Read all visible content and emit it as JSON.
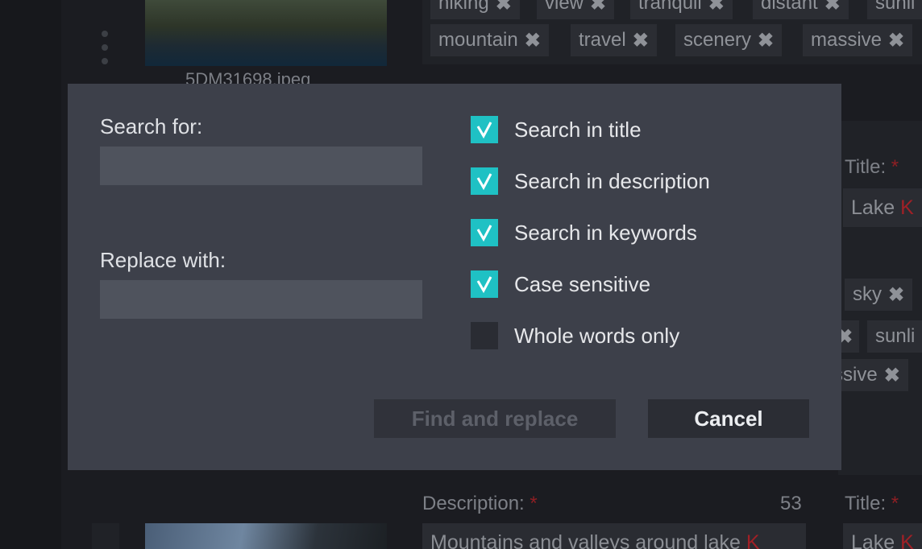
{
  "background": {
    "top_item": {
      "filename": "5DM31698.jpeg",
      "keywords_row1": [
        "hiking",
        "view",
        "tranquil",
        "distant",
        "sunli"
      ],
      "keywords_row2": [
        "mountain",
        "travel",
        "scenery",
        "massive"
      ],
      "title_label": "Title:",
      "title_value": "Lake",
      "title_value_highlight": "K",
      "keywords_right_row1": [
        "sky"
      ],
      "keywords_right_row2": [
        "sunli"
      ],
      "keywords_right_row3": [
        "ssive"
      ]
    },
    "bottom_item": {
      "description_label": "Description:",
      "description_counter": "53",
      "description_value": "Mountains and valleys around lake",
      "description_highlight": "K",
      "title_label": "Title:",
      "title_value": "Lake",
      "title_value_highlight": "K"
    },
    "required_marker": "*"
  },
  "dialog": {
    "search_label": "Search for:",
    "search_value": "",
    "replace_label": "Replace with:",
    "replace_value": "",
    "options": [
      {
        "label": "Search in title",
        "checked": true
      },
      {
        "label": "Search in description",
        "checked": true
      },
      {
        "label": "Search in keywords",
        "checked": true
      },
      {
        "label": "Case sensitive",
        "checked": true
      },
      {
        "label": "Whole words only",
        "checked": false
      }
    ],
    "find_button": "Find and replace",
    "find_enabled": false,
    "cancel_button": "Cancel"
  },
  "colors": {
    "accent": "#1fc1c4",
    "dialog_bg": "#3d404a",
    "required_red": "#a02026"
  }
}
